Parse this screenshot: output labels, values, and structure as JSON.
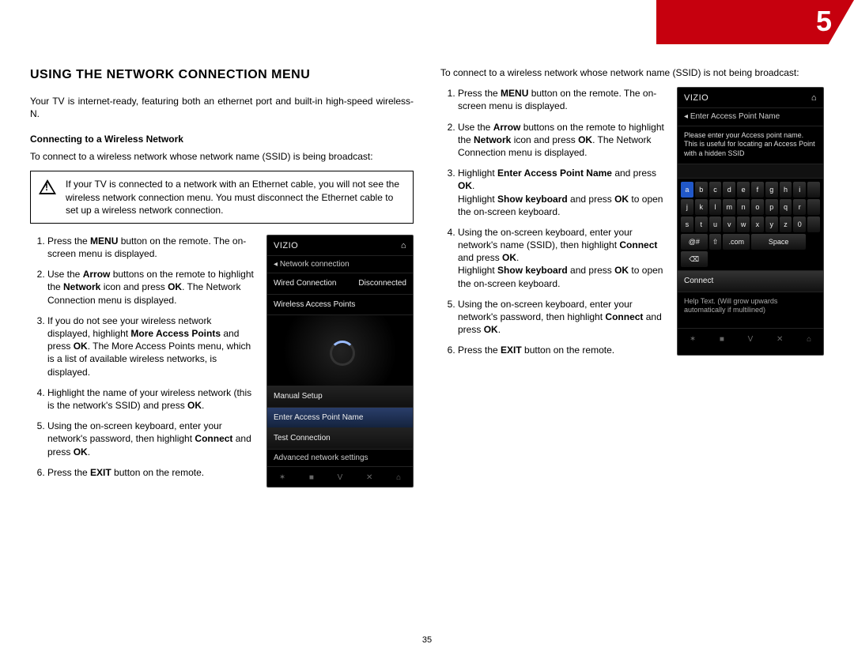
{
  "chapter": "5",
  "page_number": "35",
  "heading": "USING THE NETWORK CONNECTION MENU",
  "intro": "Your TV is internet-ready, featuring both an ethernet port and built-in high-speed wireless-N.",
  "subsection_title": "Connecting to a Wireless Network",
  "lead_broadcast": "To connect to a wireless network whose network name (SSID) is being broadcast:",
  "warning": "If your TV is connected to a network with an Ethernet cable, you will not see the wireless network connection menu. You must disconnect the Ethernet cable to set up a wireless network connection.",
  "steps_broadcast": [
    {
      "segments": [
        [
          "Press the ",
          0
        ],
        [
          "MENU",
          1
        ],
        [
          " button on the remote. The on-screen menu is displayed.",
          0
        ]
      ]
    },
    {
      "segments": [
        [
          "Use the ",
          0
        ],
        [
          "Arrow",
          1
        ],
        [
          " buttons on the remote to highlight the ",
          0
        ],
        [
          "Network",
          1
        ],
        [
          " icon and press ",
          0
        ],
        [
          "OK",
          1
        ],
        [
          ". The Network Connection menu is displayed.",
          0
        ]
      ]
    },
    {
      "segments": [
        [
          "If you do not see your wireless network displayed, highlight ",
          0
        ],
        [
          "More Access Points",
          1
        ],
        [
          " and press ",
          0
        ],
        [
          "OK",
          1
        ],
        [
          ". The More Access Points menu, which is a list of available wireless networks, is displayed.",
          0
        ]
      ]
    },
    {
      "segments": [
        [
          "Highlight the name of your wireless network (this is the network's SSID) and press ",
          0
        ],
        [
          "OK",
          1
        ],
        [
          ".",
          0
        ]
      ]
    },
    {
      "segments": [
        [
          "Using the on-screen keyboard, enter your network's password, then highlight ",
          0
        ],
        [
          "Connect",
          1
        ],
        [
          " and press ",
          0
        ],
        [
          "OK",
          1
        ],
        [
          ".",
          0
        ]
      ]
    },
    {
      "segments": [
        [
          "Press the ",
          0
        ],
        [
          "EXIT",
          1
        ],
        [
          " button on the remote.",
          0
        ]
      ]
    }
  ],
  "lead_hidden": "To connect to a wireless network whose network name (SSID) is not being broadcast:",
  "steps_hidden": [
    {
      "segments": [
        [
          "Press the ",
          0
        ],
        [
          "MENU",
          1
        ],
        [
          " button on the remote. The on-screen menu is displayed.",
          0
        ]
      ]
    },
    {
      "segments": [
        [
          "Use the ",
          0
        ],
        [
          "Arrow",
          1
        ],
        [
          " buttons on the remote to highlight the ",
          0
        ],
        [
          "Network",
          1
        ],
        [
          " icon and press ",
          0
        ],
        [
          "OK",
          1
        ],
        [
          ". The Network Connection menu is displayed.",
          0
        ]
      ]
    },
    {
      "segments": [
        [
          "Highlight ",
          0
        ],
        [
          "Enter Access Point Name",
          1
        ],
        [
          " and press ",
          0
        ],
        [
          "OK",
          1
        ],
        [
          ".",
          0
        ]
      ],
      "extra": [
        [
          "Highlight ",
          0
        ],
        [
          "Show keyboard",
          1
        ],
        [
          " and press ",
          0
        ],
        [
          "OK",
          1
        ],
        [
          " to open the on-screen keyboard.",
          0
        ]
      ]
    },
    {
      "segments": [
        [
          "Using the on-screen keyboard, enter your network's name (SSID), then highlight ",
          0
        ],
        [
          "Connect",
          1
        ],
        [
          " and press ",
          0
        ],
        [
          "OK",
          1
        ],
        [
          ".",
          0
        ]
      ],
      "extra": [
        [
          "Highlight ",
          0
        ],
        [
          "Show keyboard",
          1
        ],
        [
          " and press ",
          0
        ],
        [
          "OK",
          1
        ],
        [
          " to open the on-screen keyboard.",
          0
        ]
      ]
    },
    {
      "segments": [
        [
          "Using the on-screen keyboard, enter your network's password, then highlight ",
          0
        ],
        [
          "Connect",
          1
        ],
        [
          " and press ",
          0
        ],
        [
          "OK",
          1
        ],
        [
          ".",
          0
        ]
      ]
    },
    {
      "segments": [
        [
          "Press the ",
          0
        ],
        [
          "EXIT",
          1
        ],
        [
          " button on the remote.",
          0
        ]
      ]
    }
  ],
  "screenshot1": {
    "brand": "VIZIO",
    "title": "Network connection",
    "row1_left": "Wired Connection",
    "row1_right": "Disconnected",
    "row2": "Wireless Access Points",
    "items": [
      "Manual Setup",
      "Enter Access Point Name",
      "Test Connection"
    ],
    "footer": "Advanced network settings",
    "buttons": [
      "✶",
      "■",
      "V",
      "✕",
      "⌂"
    ]
  },
  "screenshot2": {
    "brand": "VIZIO",
    "title": "Enter Access Point Name",
    "hint": "Please enter your Access point name. This is useful for locating an Access Point with a hidden SSID",
    "keys_row1": [
      "a",
      "b",
      "c",
      "d",
      "e",
      "f",
      "g",
      "h",
      "i"
    ],
    "keys_row2": [
      "j",
      "k",
      "l",
      "m",
      "n",
      "o",
      "p",
      "q",
      "r"
    ],
    "keys_row3": [
      "s",
      "t",
      "u",
      "v",
      "w",
      "x",
      "y",
      "z",
      "0"
    ],
    "keys_row4": [
      "@#",
      "⇧",
      ".com",
      "Space",
      "⌫"
    ],
    "connect": "Connect",
    "help": "Help Text. (Will grow upwards automatically if multilined)",
    "buttons": [
      "✶",
      "■",
      "V",
      "✕",
      "⌂"
    ]
  }
}
